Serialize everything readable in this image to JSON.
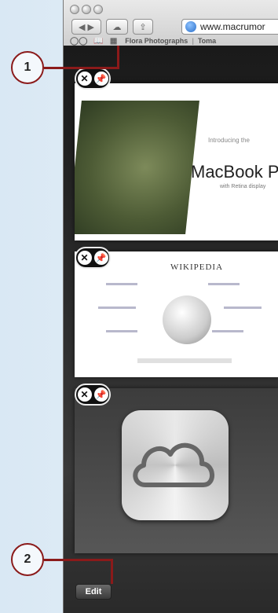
{
  "browser": {
    "url_text": "www.macrumor",
    "bookmarks": [
      "Flora Photographs",
      "|",
      "Toma"
    ]
  },
  "tabs": [
    {
      "id": "macbook",
      "title": "MacBook Pro",
      "subtitle": "with Retina display",
      "tagline": "Introducing the"
    },
    {
      "id": "wikipedia",
      "title": "WIKIPEDIA"
    },
    {
      "id": "icloud"
    }
  ],
  "bottom": {
    "edit_label": "Edit"
  },
  "callouts": [
    {
      "num": "1"
    },
    {
      "num": "2"
    }
  ],
  "colors": {
    "callout_line": "#8b1a1a",
    "background": "#dfecf6"
  }
}
